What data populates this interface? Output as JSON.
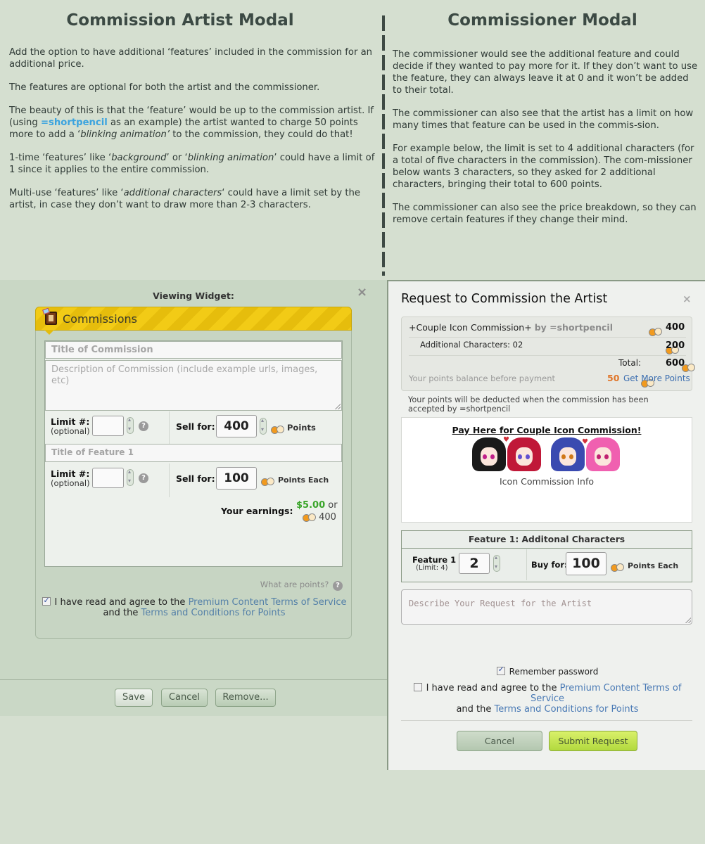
{
  "left_column": {
    "title": "Commission Artist Modal",
    "paragraphs": {
      "p1": " Add the option to have additional ‘features’ included in the commission for an additional price.",
      "p2": "The features are optional for both the artist and the commissioner.",
      "p3_a": "The beauty of this is that the ‘feature’ would be up to the commission artist. If (using ",
      "p3_user": "=shortpencil",
      "p3_b": " as an example) the artist wanted to charge 50 points more to add a ‘",
      "p3_em": "blinking animation’",
      "p3_c": " to the commission, they could do that!",
      "p4_a": "1-time ‘features’ like ‘",
      "p4_em1": "background",
      "p4_b": "’ or ‘",
      "p4_em2": "blinking animation",
      "p4_c": "’ could have a limit of 1 since it applies to the entire commission.",
      "p5_a": "Multi-use ‘features’ like ‘",
      "p5_em": "additional characters",
      "p5_b": "‘ could have a limit set by the artist, in case they don’t want to draw more than 2-3 characters."
    }
  },
  "right_column": {
    "title": "Commissioner Modal",
    "paragraphs": {
      "p1": " The commissioner would see the additional feature and could decide if they wanted to pay more for it. If they don’t want to use the feature, they can always leave it at 0 and it won’t be added to their total.",
      "p2": "The commissioner can also see that the artist has a limit on how many times that feature can be used in the commis-sion.",
      "p3": "For example below, the limit is set to 4 additional characters (for a total of five characters in the commission). The com-missioner below wants 3 characters, so they asked for 2 additional characters, bringing their total to 600 points.",
      "p4": "The commissioner can also see the price breakdown, so they can remove certain features if they change their mind."
    }
  },
  "artist_modal": {
    "viewing_label": "Viewing Widget:",
    "close_icon": "×",
    "widget_title": "Commissions",
    "title_placeholder": "Title of Commission",
    "description_placeholder": "Description of Commission (include example urls, images, etc)",
    "limit_label": "Limit #:",
    "limit_sub": "(optional)",
    "limit_value": "",
    "help_icon": "?",
    "sell_label": "Sell for:",
    "sell_value": "400",
    "points_label": "Points",
    "feature_title_placeholder": "Title of Feature 1",
    "feature_limit_value": "",
    "feature_sell_value": "100",
    "feature_points_label": "Points Each",
    "earnings_label": "Your earnings:",
    "earnings_money": "$5.00",
    "earnings_or": "or",
    "earnings_points": "400",
    "what_are_points": "What are points?",
    "agree_checked": true,
    "agree_text": "I have read and agree to the",
    "agree_link1": "Premium Content Terms of Service",
    "agree_and": "and the",
    "agree_link2": "Terms and Conditions for Points",
    "buttons": {
      "save": "Save",
      "cancel": "Cancel",
      "remove": "Remove..."
    }
  },
  "commissioner_modal": {
    "title": "Request to Commission the Artist",
    "close_icon": "×",
    "item_name": "+Couple Icon Commission+",
    "item_by": "by =shortpencil",
    "item_price": "400",
    "feature_line": "Additional Characters: 02",
    "feature_price": "200",
    "total_label": "Total:",
    "total_value": "600",
    "balance_label": "Your points balance before payment",
    "balance_value": "50",
    "get_more_points": "Get More Points",
    "deduct_note": "Your points will be deducted when the commission has been accepted by =shortpencil",
    "promo_title": "Pay Here for Couple Icon Commission!",
    "promo_info": "Icon Commission Info",
    "feature_header": "Feature 1: Additonal Characters",
    "feature_label": "Feature 1",
    "feature_limit": "(Limit: 4)",
    "feature_qty": "2",
    "buy_label": "Buy for:",
    "buy_value": "100",
    "buy_points_label": "Points Each",
    "request_placeholder": "Describe Your Request for the Artist",
    "remember_label": "Remember password",
    "remember_checked": true,
    "agree_checked": false,
    "agree_text": "I have read and agree to the",
    "agree_link1": "Premium Content Terms of Service",
    "agree_and": "and the",
    "agree_link2": "Terms and Conditions for Points",
    "cancel_label": "Cancel",
    "submit_label": "Submit Request"
  },
  "colors": {
    "page_bg": "#d5dfd0",
    "user_link": "#3aa3df",
    "earnings_green": "#3aa52a",
    "balance_orange": "#e0762a",
    "link_blue": "#4a7ab5",
    "submit_green": "#b2d93e",
    "widget_header_yellow": "#f2cb16"
  }
}
